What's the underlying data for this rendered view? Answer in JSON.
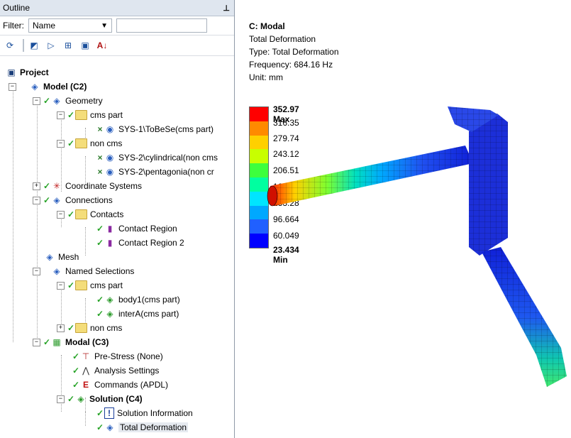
{
  "panel": {
    "title": "Outline",
    "pin": "ᵖ",
    "filter_label": "Filter:",
    "filter_value": "Name"
  },
  "toolbar": [
    "refresh-icon",
    "collapse-icon",
    "expand-icon",
    "plus-box-icon",
    "folder-icon",
    "sort-az-icon"
  ],
  "tree": [
    {
      "label": "Project",
      "bold": true
    },
    {
      "label": "Model (C2)",
      "bold": true
    },
    {
      "label": "Geometry"
    },
    {
      "label": "cms part"
    },
    {
      "label": "SYS-1\\ToBeSe(cms part)"
    },
    {
      "label": "non cms"
    },
    {
      "label": "SYS-2\\cylindrical(non cms"
    },
    {
      "label": "SYS-2\\pentagonia(non cr"
    },
    {
      "label": "Coordinate Systems"
    },
    {
      "label": "Connections"
    },
    {
      "label": "Contacts"
    },
    {
      "label": "Contact Region"
    },
    {
      "label": "Contact Region 2"
    },
    {
      "label": "Mesh"
    },
    {
      "label": "Named Selections"
    },
    {
      "label": "cms part"
    },
    {
      "label": "body1(cms part)"
    },
    {
      "label": "interA(cms part)"
    },
    {
      "label": "non cms"
    },
    {
      "label": "Modal (C3)",
      "bold": true
    },
    {
      "label": "Pre-Stress (None)"
    },
    {
      "label": "Analysis Settings"
    },
    {
      "label": "Commands (APDL)"
    },
    {
      "label": "Solution (C4)",
      "bold": true
    },
    {
      "label": "Solution Information"
    },
    {
      "label": "Total Deformation"
    }
  ],
  "viewport": {
    "title": "C: Modal",
    "line1": "Total Deformation",
    "line2": "Type: Total Deformation",
    "line3": "Frequency: 684.16 Hz",
    "line4": "Unit: mm"
  },
  "legend": {
    "values": [
      "352.97 Max",
      "316.35",
      "279.74",
      "243.12",
      "206.51",
      "169.89",
      "133.28",
      "96.664",
      "60.049",
      "23.434 Min"
    ],
    "colors": [
      "#ff0000",
      "#ff8a00",
      "#ffd000",
      "#c8ff00",
      "#3dff3d",
      "#00ffa0",
      "#00e5ff",
      "#00a8ff",
      "#2060ff",
      "#0000ff"
    ]
  }
}
